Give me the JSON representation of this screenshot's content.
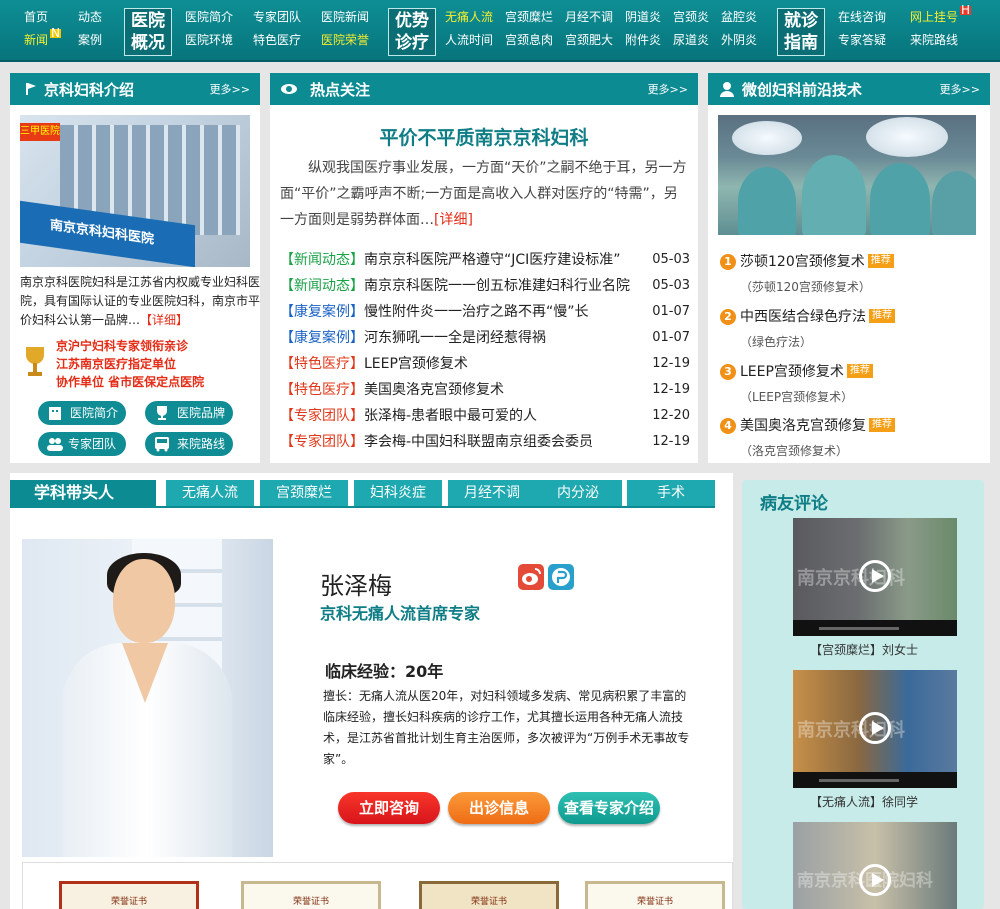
{
  "nav": {
    "col1": [
      "首页",
      "新闻"
    ],
    "col1_badge": "N",
    "col2": [
      "动态",
      "案例"
    ],
    "big1": [
      "医院",
      "概况"
    ],
    "col3": [
      "医院简介",
      "医院环境"
    ],
    "col4": [
      "专家团队",
      "特色医疗"
    ],
    "col5": [
      "医院新闻",
      "医院荣誉"
    ],
    "big2": [
      "优势",
      "诊疗"
    ],
    "col6": [
      "无痛人流",
      "人流时间"
    ],
    "col7": [
      "宫颈糜烂",
      "宫颈息肉"
    ],
    "col8": [
      "月经不调",
      "宫颈肥大"
    ],
    "col9": [
      "阴道炎",
      "附件炎"
    ],
    "col10": [
      "宫颈炎",
      "尿道炎"
    ],
    "col11": [
      "盆腔炎",
      "外阴炎"
    ],
    "big3": [
      "就诊",
      "指南"
    ],
    "col12": [
      "在线咨询",
      "专家答疑"
    ],
    "col13": [
      "网上挂号",
      "来院路线"
    ],
    "col13_badge": "H"
  },
  "intro": {
    "title": "京科妇科介绍",
    "more": "更多>>",
    "img_tag": "三甲医院",
    "img_sign": "南京京科妇科医院",
    "text": "南京京科医院妇科是江苏省内权威专业妇科医院，具有国际认证的专业医院妇科，南京市平价妇科公认第一品牌…",
    "detail": "【详细】",
    "honor": [
      "京沪宁妇科专家领衔亲诊",
      "江苏南京医疗指定单位",
      "协作单位 省市医保定点医院"
    ],
    "buttons": [
      "医院简介",
      "医院品牌",
      "专家团队",
      "来院路线"
    ]
  },
  "hot": {
    "title": "热点关注",
    "more": "更多>>",
    "headline": "平价不平质南京京科妇科",
    "para": "纵观我国医疗事业发展，一方面“天价”之嗣不绝于耳，另一方面“平价”之霸呼声不断;一方面是高收入人群对医疗的“特需”，另一方面则是弱势群体面…",
    "detail": "[详细]",
    "news": [
      {
        "cat": "【新闻动态】",
        "text": "南京京科医院严格遵守“JCI医疗建设标准”",
        "date": "05-03",
        "color": "#1aa247"
      },
      {
        "cat": "【新闻动态】",
        "text": "南京京科医院一一创五标准建妇科行业名院",
        "date": "05-03",
        "color": "#1aa247"
      },
      {
        "cat": "【康复案例】",
        "text": "慢性附件炎一一治疗之路不再“慢”长",
        "date": "01-07",
        "color": "#1a62c4"
      },
      {
        "cat": "【康复案例】",
        "text": "河东狮吼一一全是闭经惹得祸",
        "date": "01-07",
        "color": "#1a62c4"
      },
      {
        "cat": "【特色医疗】",
        "text": "LEEP宫颈修复术",
        "date": "12-19",
        "color": "#e0381a"
      },
      {
        "cat": "【特色医疗】",
        "text": "美国奥洛克宫颈修复术",
        "date": "12-19",
        "color": "#e0381a"
      },
      {
        "cat": "【专家团队】",
        "text": "张泽梅-患者眼中最可爱的人",
        "date": "12-20",
        "color": "#e0381a"
      },
      {
        "cat": "【专家团队】",
        "text": "李会梅-中国妇科联盟南京组委会委员",
        "date": "12-19",
        "color": "#e0381a"
      }
    ]
  },
  "tech": {
    "title": "微创妇科前沿技术",
    "more": "更多>>",
    "items": [
      {
        "num": "1",
        "name": "莎顿120宫颈修复术",
        "tag": "推荐",
        "sub": "（莎顿120宫颈修复术）"
      },
      {
        "num": "2",
        "name": "中西医结合绿色疗法",
        "tag": "推荐",
        "sub": "（绿色疗法）"
      },
      {
        "num": "3",
        "name": "LEEP宫颈修复术",
        "tag": "推荐",
        "sub": "（LEEP宫颈修复术）"
      },
      {
        "num": "4",
        "name": "美国奥洛克宫颈修复",
        "tag": "推荐",
        "sub": "（洛克宫颈修复术）"
      }
    ]
  },
  "leader": {
    "tab_main": "学科带头人",
    "tabs": [
      "无痛人流",
      "宫颈糜烂",
      "妇科炎症",
      "月经不调",
      "内分泌",
      "手术"
    ],
    "name": "张泽梅",
    "title": "京科无痛人流首席专家",
    "exp": "临床经验：20年",
    "desc": "擅长：无痛人流从医20年，对妇科领域多发病、常见病积累了丰富的临床经验，擅长妇科疾病的诊疗工作，尤其擅长运用各种无痛人流技术，是江苏省首批计划生育主治医师，多次被评为“万例手术无事故专家”。",
    "btn_consult": "立即咨询",
    "btn_schedule": "出诊信息",
    "btn_intro": "查看专家介绍",
    "certs": [
      "荣誉证书",
      "荣誉证书",
      "荣誉证书",
      "荣誉证书"
    ]
  },
  "review": {
    "title": "病友评论",
    "videos": [
      {
        "caption": "【宫颈糜烂】刘女士",
        "watermark": "南京京科妇科"
      },
      {
        "caption": "【无痛人流】徐同学",
        "watermark": "南京京科妇科"
      },
      {
        "caption": "",
        "watermark": "南京京科医院妇科"
      }
    ]
  },
  "colors": {
    "teal": "#0c8b93",
    "tab": "#1ea8b0",
    "red": "#e42c16",
    "yellow": "#f5ee30"
  }
}
